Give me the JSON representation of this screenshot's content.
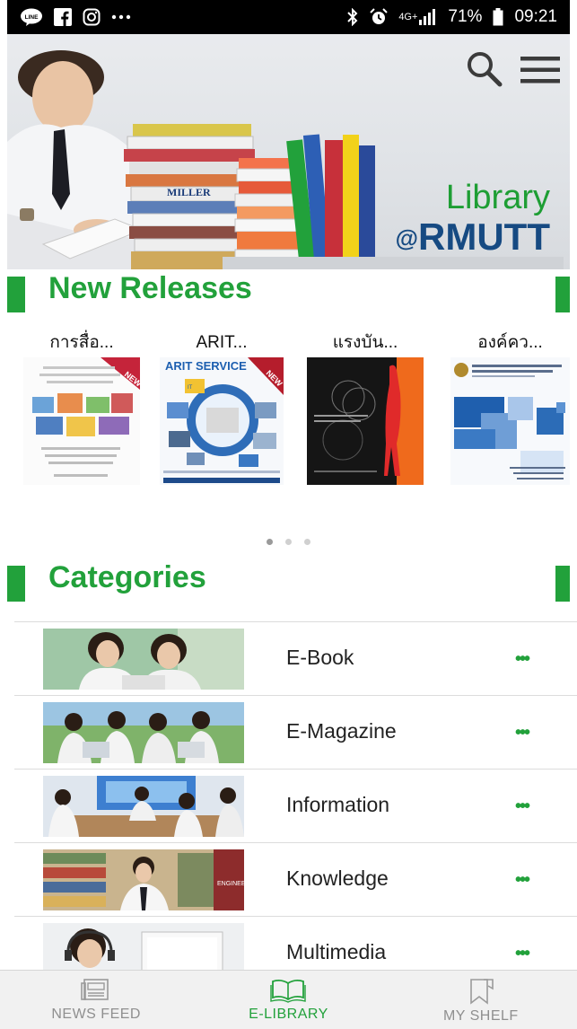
{
  "status_bar": {
    "left_icons": [
      "line-app-icon",
      "facebook-icon",
      "instagram-icon",
      "more-dots-icon"
    ],
    "right_icons": [
      "bluetooth-icon",
      "alarm-icon",
      "signal-icon",
      "battery-icon"
    ],
    "network": "4G+",
    "battery": "71%",
    "time": "09:21"
  },
  "banner": {
    "line1": "Library",
    "at": "@",
    "line2": "RMUTT",
    "colors": {
      "green": "#1e9e34",
      "blue": "#164a82"
    }
  },
  "new_releases": {
    "title": "New Releases",
    "books": [
      {
        "title": "การสื่อ..."
      },
      {
        "title": "ARIT..."
      },
      {
        "title": "แรงบัน..."
      },
      {
        "title": "องค์คว..."
      }
    ],
    "dots": {
      "count": 3,
      "active": 0
    }
  },
  "categories": {
    "title": "Categories",
    "items": [
      {
        "label": "E-Book",
        "more": "•••"
      },
      {
        "label": "E-Magazine",
        "more": "•••"
      },
      {
        "label": "Information",
        "more": "•••"
      },
      {
        "label": "Knowledge",
        "more": "•••"
      },
      {
        "label": "Multimedia",
        "more": "•••"
      }
    ]
  },
  "bottom_nav": {
    "items": [
      {
        "label": "NEWS FEED",
        "icon": "newspaper-icon",
        "active": false
      },
      {
        "label": "E-LIBRARY",
        "icon": "open-book-icon",
        "active": true
      },
      {
        "label": "MY SHELF",
        "icon": "bookmark-icon",
        "active": false
      }
    ]
  },
  "accent_color": "#22a13b"
}
